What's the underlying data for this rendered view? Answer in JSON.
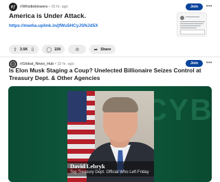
{
  "posts": [
    {
      "subreddit": "r/Whistleblowers",
      "separator": "•",
      "age": "15 hr. ago",
      "join_label": "Join",
      "more_label": "•••",
      "title": "America is Under Attack.",
      "link": "https://media.uplink.in/jfWu5HCyJSNJd5X",
      "upvotes": "3.5K",
      "comments": "226",
      "share_label": "Share",
      "icons": {
        "upvote": "arrow-up-icon",
        "downvote": "arrow-down-icon",
        "comment": "speech-bubble-icon",
        "award": "award-icon",
        "share": "share-arrow-icon"
      }
    },
    {
      "subreddit": "r/Global_News_Hub",
      "separator": "•",
      "age": "15 hr. ago",
      "join_label": "Join",
      "more_label": "•••",
      "title": "Is Elon Musk Staging a Coup? Unelected Billionaire Seizes Control at Treasury Dept. & Other Agencies",
      "image": {
        "caption_name": "David Lebryk",
        "caption_subtitle": "Top Treasury Dept. Official Who Left Friday"
      }
    }
  ],
  "colors": {
    "join_button": "#0a449b",
    "link": "#1a6bd4",
    "media_bg": "#0e5a3d"
  }
}
